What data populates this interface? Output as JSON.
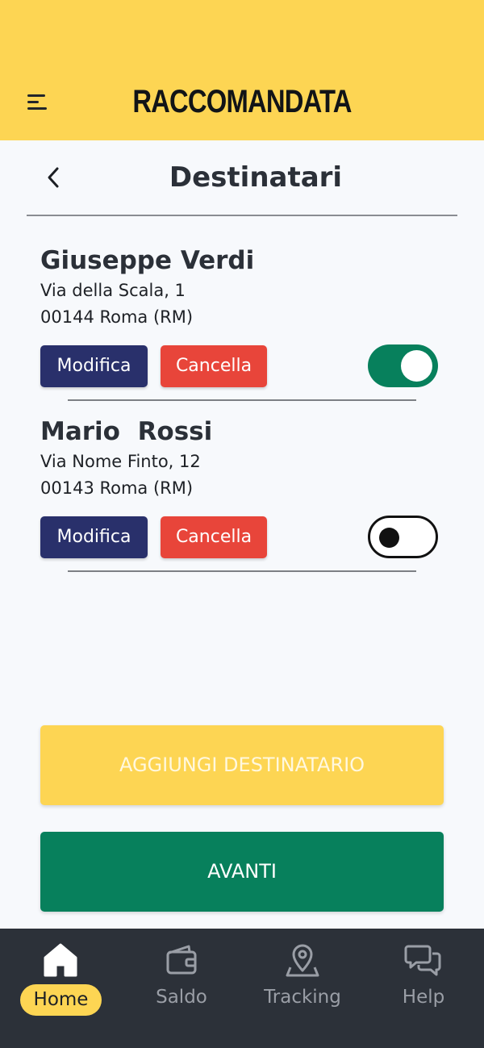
{
  "header": {
    "app_title": "RACCOMANDATA",
    "menu_icon": "hamburger-menu-icon",
    "brand_color": "#fdd553"
  },
  "subheader": {
    "title": "Destinatari",
    "back_icon": "chevron-left-icon"
  },
  "recipients": [
    {
      "name": "Giuseppe Verdi",
      "address_line1": "Via della Scala, 1",
      "address_line2": "00144 Roma (RM)",
      "edit_label": "Modifica",
      "delete_label": "Cancella",
      "selected": true
    },
    {
      "name": "Mario  Rossi",
      "address_line1": "Via Nome Finto, 12",
      "address_line2": "00143 Roma (RM)",
      "edit_label": "Modifica",
      "delete_label": "Cancella",
      "selected": false
    }
  ],
  "actions": {
    "add_label": "AGGIUNGI DESTINATARIO",
    "next_label": "AVANTI"
  },
  "colors": {
    "edit": "#29306b",
    "delete": "#e8453a",
    "primary_green": "#07805c",
    "nav_bg": "#2c3139"
  },
  "bottom_nav": {
    "items": [
      {
        "label": "Home",
        "icon": "home-icon",
        "active": true
      },
      {
        "label": "Saldo",
        "icon": "wallet-icon",
        "active": false
      },
      {
        "label": "Tracking",
        "icon": "map-pin-icon",
        "active": false
      },
      {
        "label": "Help",
        "icon": "chat-bubbles-icon",
        "active": false
      }
    ]
  }
}
